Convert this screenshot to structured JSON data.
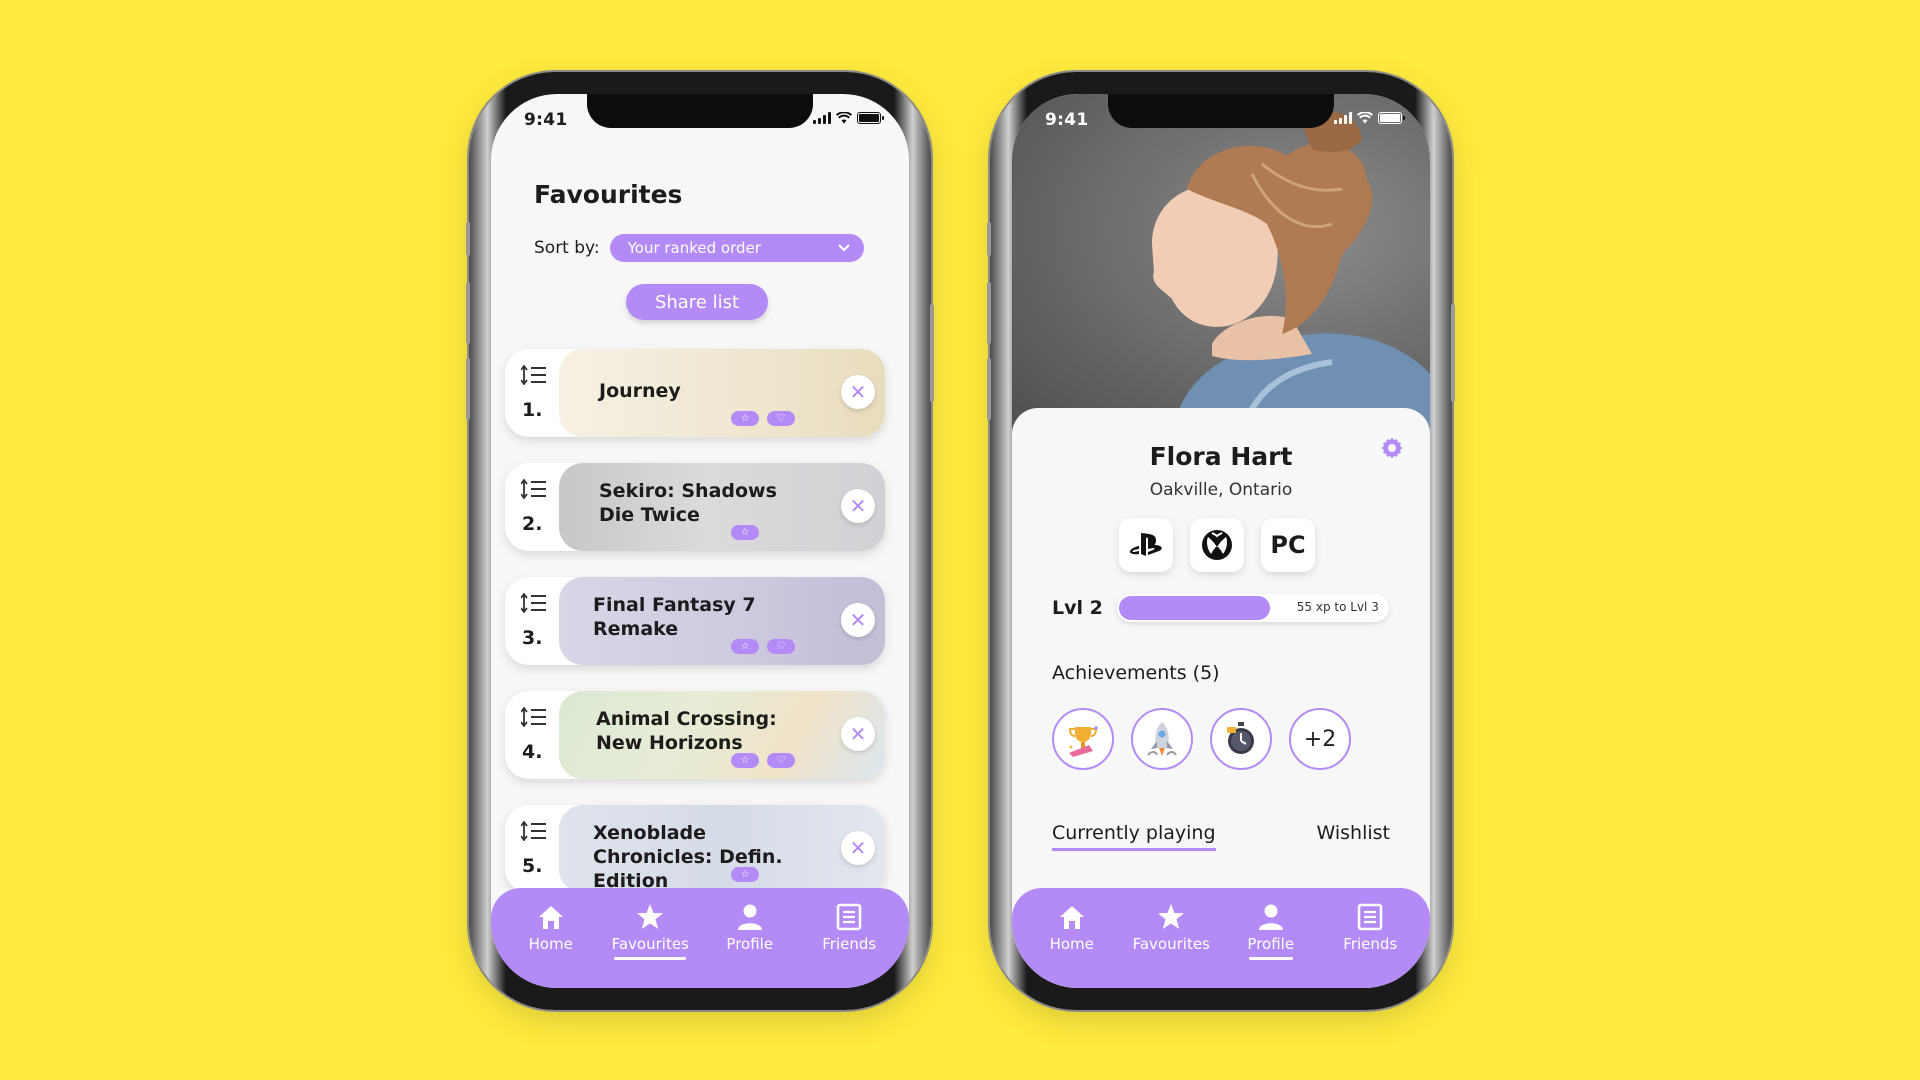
{
  "status_bar": {
    "time": "9:41"
  },
  "favourites_screen": {
    "title": "Favourites",
    "sort_label": "Sort by:",
    "sort_value": "Your ranked order",
    "share_button": "Share list",
    "items": [
      {
        "rank": "1.",
        "title": "Journey",
        "pills": [
          "star-icon",
          "heart-icon"
        ]
      },
      {
        "rank": "2.",
        "title": "Sekiro: Shadows Die Twice",
        "pills": [
          "star-icon"
        ]
      },
      {
        "rank": "3.",
        "title": "Final Fantasy 7 Remake",
        "pills": [
          "star-icon",
          "heart-icon"
        ]
      },
      {
        "rank": "4.",
        "title": "Animal Crossing: New Horizons",
        "pills": [
          "star-icon",
          "heart-icon"
        ]
      },
      {
        "rank": "5.",
        "title": "Xenoblade Chronicles: Defin. Edition",
        "pills": [
          "star-icon"
        ]
      }
    ]
  },
  "nav": {
    "items": [
      {
        "label": "Home",
        "icon": "home-icon"
      },
      {
        "label": "Favourites",
        "icon": "star-icon"
      },
      {
        "label": "Profile",
        "icon": "user-icon"
      },
      {
        "label": "Friends",
        "icon": "list-icon"
      }
    ]
  },
  "profile_screen": {
    "name": "Flora Hart",
    "location": "Oakville, Ontario",
    "platforms": [
      "playstation-icon",
      "xbox-icon",
      "PC"
    ],
    "level_label": "Lvl 2",
    "xp_text": "55 xp to Lvl 3",
    "level_progress": 0.57,
    "achievements_title": "Achievements (5)",
    "achievements": [
      "trophy-icon",
      "rocket-icon",
      "stopwatch-icon"
    ],
    "achievements_more": "+2",
    "tabs": [
      "Currently playing",
      "Wishlist"
    ]
  },
  "colors": {
    "accent": "#b48af6",
    "background": "#ffeb3e"
  }
}
